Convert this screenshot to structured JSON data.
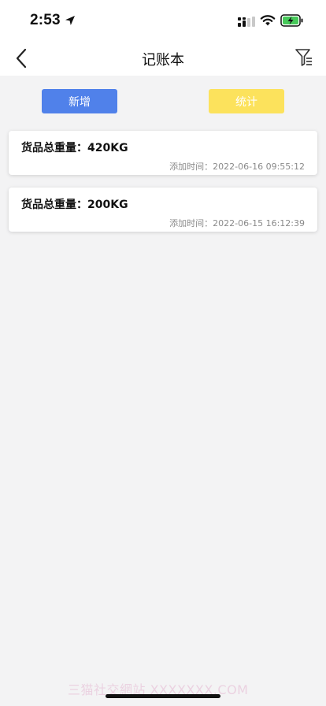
{
  "status_bar": {
    "time": "2:53",
    "icons": [
      "location-arrow-icon",
      "cellular-signal-icon",
      "wifi-icon",
      "battery-charging-icon"
    ]
  },
  "nav": {
    "title": "记账本",
    "back_icon": "chevron-left-icon",
    "filter_icon": "filter-icon"
  },
  "actions": {
    "add_label": "新增",
    "stats_label": "统计",
    "add_color": "#5081ea",
    "stats_color": "#fce25c"
  },
  "records": [
    {
      "title": "货品总重量：420KG",
      "time": "添加时间：2022-06-16 09:55:12"
    },
    {
      "title": "货品总重量：200KG",
      "time": "添加时间：2022-06-15 16:12:39"
    }
  ],
  "watermark": "三猫社交網站 XXXXXXX.COM"
}
